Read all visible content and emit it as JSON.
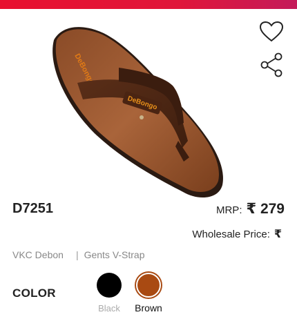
{
  "product": {
    "sku": "D7251",
    "mrp_label": "MRP:",
    "currency_symbol": "₹",
    "mrp_price": "279",
    "wholesale_label": "Wholesale Price:",
    "brand": "VKC Debon",
    "separator": "|",
    "category": "Gents V-Strap",
    "strap_logo_text": "DeBongo",
    "footbed_logo_text": "DeBongo"
  },
  "actions": {
    "wishlist_icon": "heart-outline-icon",
    "share_icon": "share-icon"
  },
  "color_section": {
    "label": "COLOR",
    "options": [
      {
        "name": "Black",
        "hex": "#000000",
        "selected": false
      },
      {
        "name": "Brown",
        "hex": "#a94a12",
        "selected": true
      }
    ]
  },
  "theme": {
    "accent": "#e8102f",
    "text": "#222222",
    "muted": "#888888"
  }
}
